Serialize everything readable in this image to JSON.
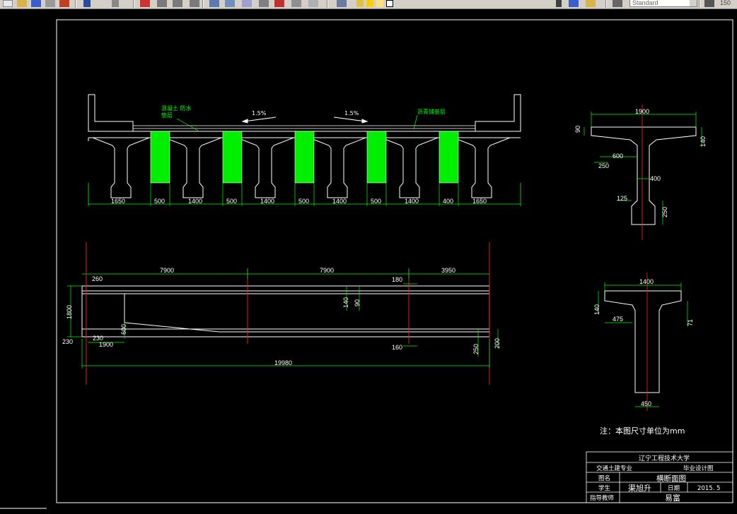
{
  "toolbar": {
    "text_style": "Standard",
    "scale_readout": "150"
  },
  "cross_section": {
    "label_waterproof_1": "混凝土 防水",
    "label_waterproof_2": "垫层",
    "label_asphalt": "沥青铺装层",
    "slope_left": "1.5%",
    "slope_right": "1.5%",
    "dims": [
      "1650",
      "500",
      "1400",
      "500",
      "1400",
      "500",
      "1400",
      "500",
      "1400",
      "400",
      "1650"
    ]
  },
  "t_section_top": {
    "dims": {
      "width": "1900",
      "top_left": "90",
      "right": "140",
      "inner": "600",
      "edge": "250",
      "web": "400",
      "bottom_left": "125",
      "bottom_right": "250"
    }
  },
  "elevation": {
    "dims": {
      "seg1": "7900",
      "seg2": "7900",
      "seg3": "3950",
      "left_260": "260",
      "height_1800": "1800",
      "bottom_230a": "230",
      "bottom_230b": "230",
      "bottom_1900": "1900",
      "height_600": "600",
      "mid_140": "140",
      "mid_90": "90",
      "top_180": "180",
      "bot_160": "160",
      "bot_250": "250",
      "bot_200": "200",
      "total": "19980"
    }
  },
  "t_section_bottom": {
    "dims": {
      "width": "1400",
      "flange": "140",
      "haunch": "475",
      "right": "71",
      "web": "450"
    }
  },
  "note": "注：本图尺寸单位为mm",
  "title_block": {
    "university": "辽宁工程技术大学",
    "major": "交通土建专业",
    "design_type": "毕业设计图",
    "drawing_name_label": "图名",
    "drawing_name": "横断面图",
    "student_label": "学生",
    "student": "渠旭升",
    "date_label": "日期",
    "date": "2015. 5",
    "advisor_label": "指导教师",
    "advisor": "易富"
  }
}
